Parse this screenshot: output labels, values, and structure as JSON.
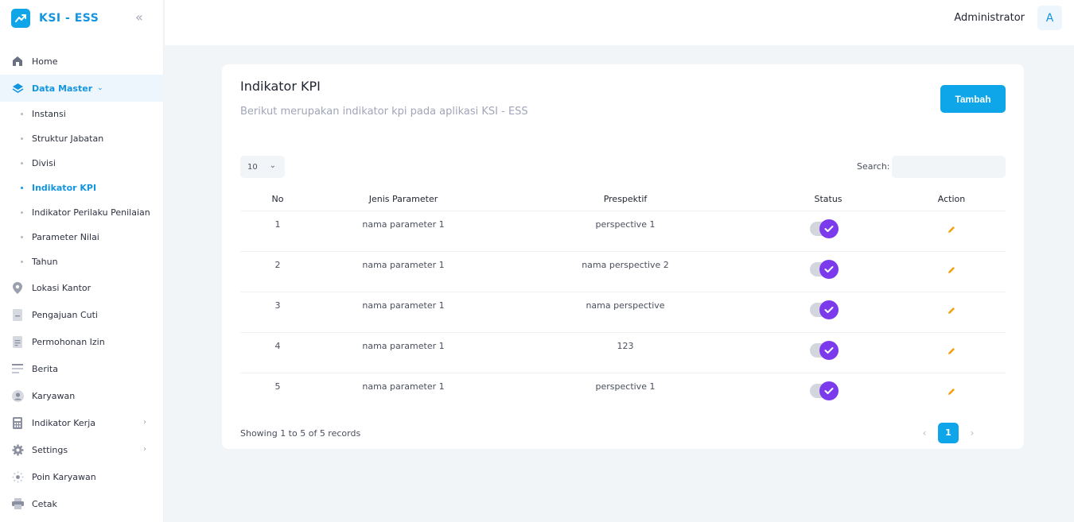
{
  "app": {
    "title": "KSI - ESS"
  },
  "header": {
    "user_name": "Administrator",
    "avatar_initial": "A"
  },
  "sidebar": {
    "items": [
      {
        "label": "Home",
        "icon": "home-icon"
      },
      {
        "label": "Data Master",
        "icon": "layers-icon",
        "active": true,
        "expanded": true,
        "children": [
          {
            "label": "Instansi"
          },
          {
            "label": "Struktur Jabatan"
          },
          {
            "label": "Divisi"
          },
          {
            "label": "Indikator KPI",
            "active": true
          },
          {
            "label": "Indikator Perilaku Penilaian"
          },
          {
            "label": "Parameter Nilai"
          },
          {
            "label": "Tahun"
          }
        ]
      },
      {
        "label": "Lokasi Kantor",
        "icon": "location-pin-icon"
      },
      {
        "label": "Pengajuan Cuti",
        "icon": "document-icon"
      },
      {
        "label": "Permohonan Izin",
        "icon": "file-text-icon"
      },
      {
        "label": "Berita",
        "icon": "news-icon"
      },
      {
        "label": "Karyawan",
        "icon": "user-icon"
      },
      {
        "label": "Indikator Kerja",
        "icon": "calculator-icon",
        "has_submenu": true
      },
      {
        "label": "Settings",
        "icon": "gear-icon",
        "has_submenu": true
      },
      {
        "label": "Poin Karyawan",
        "icon": "sun-icon"
      },
      {
        "label": "Cetak",
        "icon": "printer-icon"
      }
    ]
  },
  "page": {
    "title": "Indikator KPI",
    "subtitle": "Berikut merupakan indikator kpi pada aplikasi KSI - ESS",
    "add_button": "Tambah"
  },
  "table": {
    "page_length": "10",
    "search_label": "Search:",
    "search_value": "",
    "columns": [
      "No",
      "Jenis Parameter",
      "Prespektif",
      "Status",
      "Action"
    ],
    "rows": [
      {
        "no": "1",
        "jenis": "nama parameter 1",
        "perspektif": "perspective 1",
        "status": true
      },
      {
        "no": "2",
        "jenis": "nama parameter 1",
        "perspektif": "nama perspective 2",
        "status": true
      },
      {
        "no": "3",
        "jenis": "nama parameter 1",
        "perspektif": "nama perspective",
        "status": true
      },
      {
        "no": "4",
        "jenis": "nama parameter 1",
        "perspektif": "123",
        "status": true
      },
      {
        "no": "5",
        "jenis": "nama parameter 1",
        "perspektif": "perspective 1",
        "status": true
      }
    ],
    "info": "Showing 1 to 5 of 5 records",
    "pagination": {
      "current": "1"
    }
  },
  "colors": {
    "accent": "#0ea5e9",
    "active_text": "#1395e0",
    "toggle_on": "#7c3aed",
    "edit_icon": "#f59e0b"
  }
}
